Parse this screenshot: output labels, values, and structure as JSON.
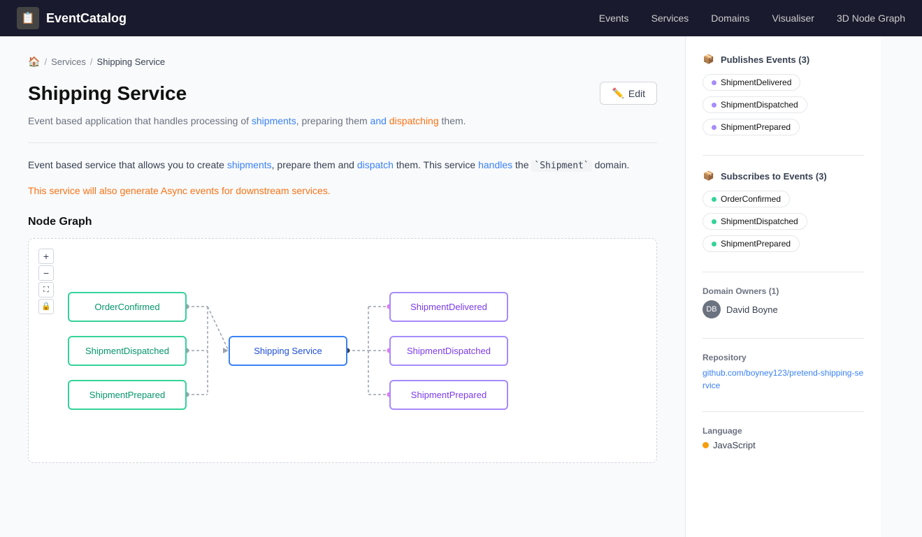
{
  "nav": {
    "logo_text": "EventCatalog",
    "logo_icon": "📋",
    "links": [
      "Events",
      "Services",
      "Domains",
      "Visualiser",
      "3D Node Graph"
    ]
  },
  "breadcrumb": {
    "home_icon": "🏠",
    "items": [
      "Services",
      "Shipping Service"
    ]
  },
  "page": {
    "title": "Shipping Service",
    "edit_button": "Edit",
    "description": "Event based application that handles processing of shipments, preparing them and dispatching them.",
    "body_text1_part1": "Event based service that allows you to create shipments, prepare them and dispatch them. This service handles the ",
    "body_code": "`Shipment`",
    "body_text1_part2": " domain.",
    "async_note": "This service will also generate Async events for downstream services.",
    "node_graph_title": "Node Graph"
  },
  "graph": {
    "controls": [
      "+",
      "−",
      "⛶",
      "🔒"
    ],
    "left_nodes": [
      {
        "label": "OrderConfirmed",
        "type": "green"
      },
      {
        "label": "ShipmentDispatched",
        "type": "green"
      },
      {
        "label": "ShipmentPrepared",
        "type": "green"
      }
    ],
    "center_node": {
      "label": "Shipping Service",
      "type": "blue"
    },
    "right_nodes": [
      {
        "label": "ShipmentDelivered",
        "type": "purple"
      },
      {
        "label": "ShipmentDispatched",
        "type": "purple"
      },
      {
        "label": "ShipmentPrepared",
        "type": "purple"
      }
    ]
  },
  "sidebar": {
    "publishes_title": "Publishes Events (3)",
    "publishes_events": [
      {
        "label": "ShipmentDelivered",
        "dot": "purple"
      },
      {
        "label": "ShipmentDispatched",
        "dot": "purple"
      },
      {
        "label": "ShipmentPrepared",
        "dot": "purple"
      }
    ],
    "subscribes_title": "Subscribes to Events (3)",
    "subscribes_events": [
      {
        "label": "OrderConfirmed",
        "dot": "green"
      },
      {
        "label": "ShipmentDispatched",
        "dot": "green"
      },
      {
        "label": "ShipmentPrepared",
        "dot": "green"
      }
    ],
    "domain_owners_title": "Domain Owners (1)",
    "owner_name": "David Boyne",
    "repository_label": "Repository",
    "repo_url": "github.com/boyney123/pretend-shipping-service",
    "language_label": "Language",
    "language": "JavaScript",
    "lang_dot_color": "#f59e0b"
  }
}
